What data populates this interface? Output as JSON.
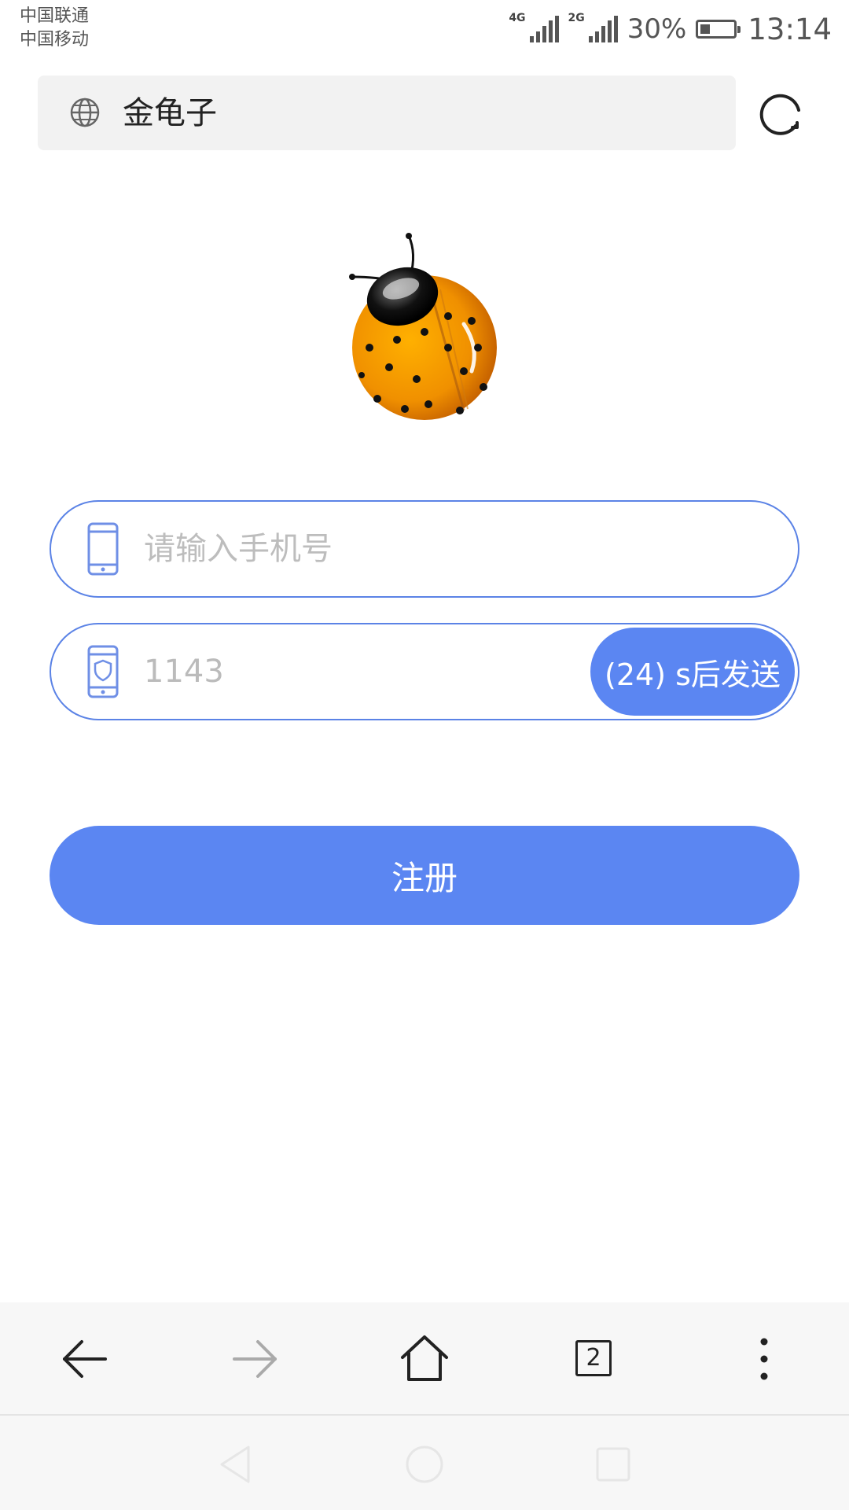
{
  "status_bar": {
    "carrier_1": "中国联通",
    "carrier_2": "中国移动",
    "network_1": "4G",
    "network_2": "2G",
    "battery_percent": "30%",
    "battery_level": 0.3,
    "time": "13:14"
  },
  "address_bar": {
    "title": "金龟子",
    "site_icon": "globe-icon",
    "reload_icon": "refresh-icon"
  },
  "logo": {
    "icon": "ladybug-logo"
  },
  "form": {
    "phone": {
      "placeholder": "请输入手机号",
      "value": "",
      "icon": "phone-icon"
    },
    "code": {
      "value": "1143",
      "icon": "shield-phone-icon",
      "send_label": "(24) s后发送"
    },
    "register_label": "注册"
  },
  "toolbar": {
    "back_icon": "arrow-left-icon",
    "forward_icon": "arrow-right-icon",
    "home_icon": "home-icon",
    "tabs_count": "2",
    "menu_icon": "more-vertical-icon"
  },
  "colors": {
    "accent": "#5b86f2",
    "input_border": "#5b83e6",
    "placeholder": "#bdbdbd"
  }
}
